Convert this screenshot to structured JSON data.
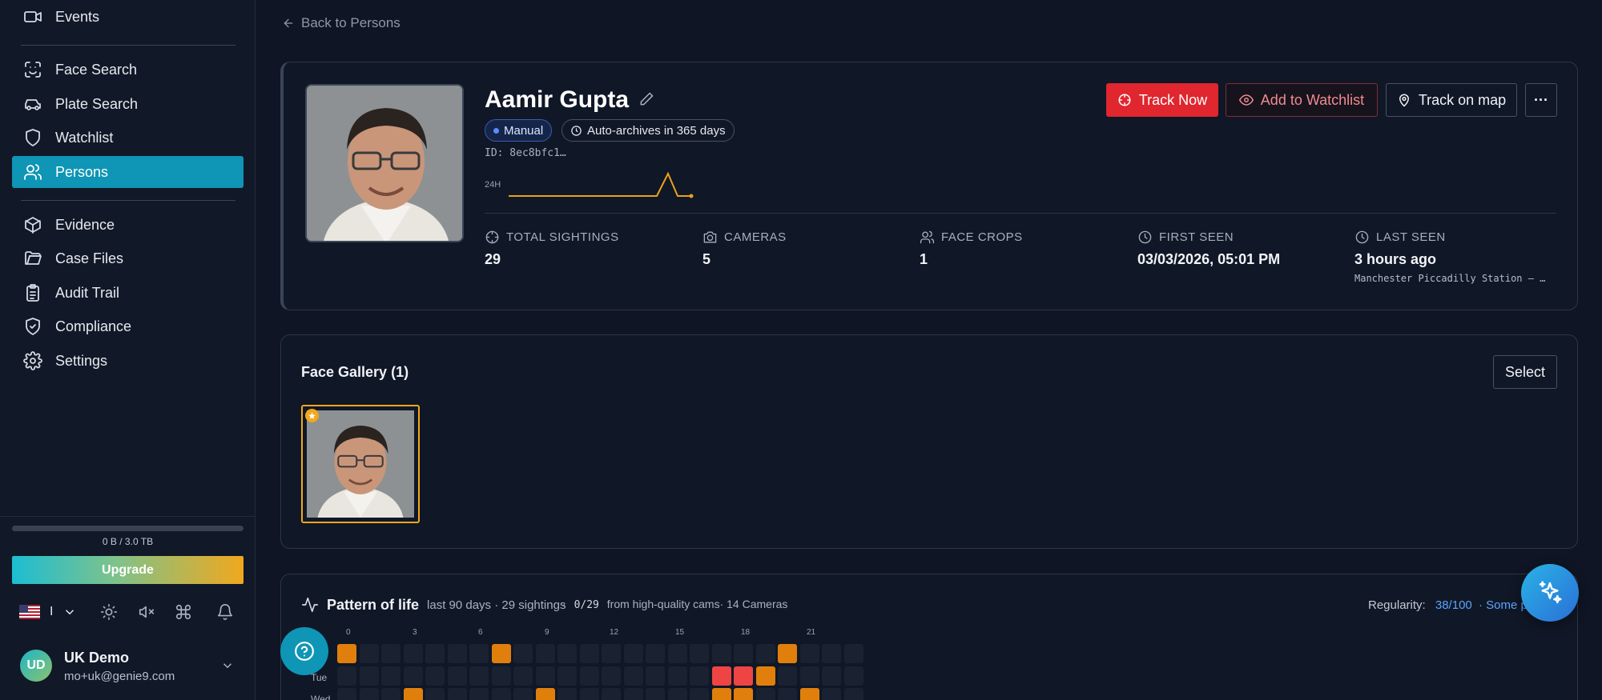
{
  "sidebar": {
    "items": [
      {
        "label": "Events",
        "icon": "video-icon"
      },
      {
        "label": "Face Search",
        "icon": "face-scan-icon"
      },
      {
        "label": "Plate Search",
        "icon": "car-icon"
      },
      {
        "label": "Watchlist",
        "icon": "shield-icon"
      },
      {
        "label": "Persons",
        "icon": "users-icon",
        "active": true
      },
      {
        "label": "Evidence",
        "icon": "package-icon"
      },
      {
        "label": "Case Files",
        "icon": "folder-icon"
      },
      {
        "label": "Audit Trail",
        "icon": "clipboard-icon"
      },
      {
        "label": "Compliance",
        "icon": "shield-check-icon"
      },
      {
        "label": "Settings",
        "icon": "gear-icon"
      }
    ],
    "storage": {
      "text": "0 B / 3.0 TB",
      "fraction": 0.0
    },
    "upgrade_label": "Upgrade",
    "language_label": "I",
    "user": {
      "initials": "UD",
      "name": "UK Demo",
      "email": "mo+uk@genie9.com"
    }
  },
  "back_label": "Back to Persons",
  "person": {
    "name": "Aamir Gupta",
    "badge_manual": "Manual",
    "badge_archive": "Auto-archives in 365 days",
    "id_line": "ID: 8ec8bfc1…",
    "spark_label": "24H",
    "stats": [
      {
        "label": "TOTAL SIGHTINGS",
        "value": "29",
        "icon": "crosshair-icon"
      },
      {
        "label": "CAMERAS",
        "value": "5",
        "icon": "camera-icon"
      },
      {
        "label": "FACE CROPS",
        "value": "1",
        "icon": "users-icon"
      },
      {
        "label": "FIRST SEEN",
        "value": "03/03/2026, 05:01 PM",
        "icon": "clock-icon"
      },
      {
        "label": "LAST SEEN",
        "value": "3 hours ago",
        "sub": "Manchester Piccadilly Station — …",
        "icon": "clock-icon"
      }
    ],
    "actions": {
      "track": "Track Now",
      "watchlist": "Add to Watchlist",
      "map": "Track on map",
      "more": "···"
    }
  },
  "gallery": {
    "title": "Face Gallery (1)",
    "select_label": "Select"
  },
  "pattern": {
    "title": "Pattern of life",
    "meta": "last 90 days · 29 sightings",
    "sep": "·",
    "hq": "0/29",
    "hq_suffix": "from high-quality cams· 14 Cameras",
    "regularity_label": "Regularity:",
    "regularity_value": "38/100",
    "regularity_note": "· Some p",
    "hour_labels": [
      "0",
      "3",
      "6",
      "9",
      "12",
      "15",
      "18",
      "21"
    ],
    "day_labels": [
      "Tue",
      "Wed"
    ]
  },
  "colors": {
    "accent": "#0f95b5",
    "danger": "#e0262e",
    "warn": "#e07f0c"
  }
}
